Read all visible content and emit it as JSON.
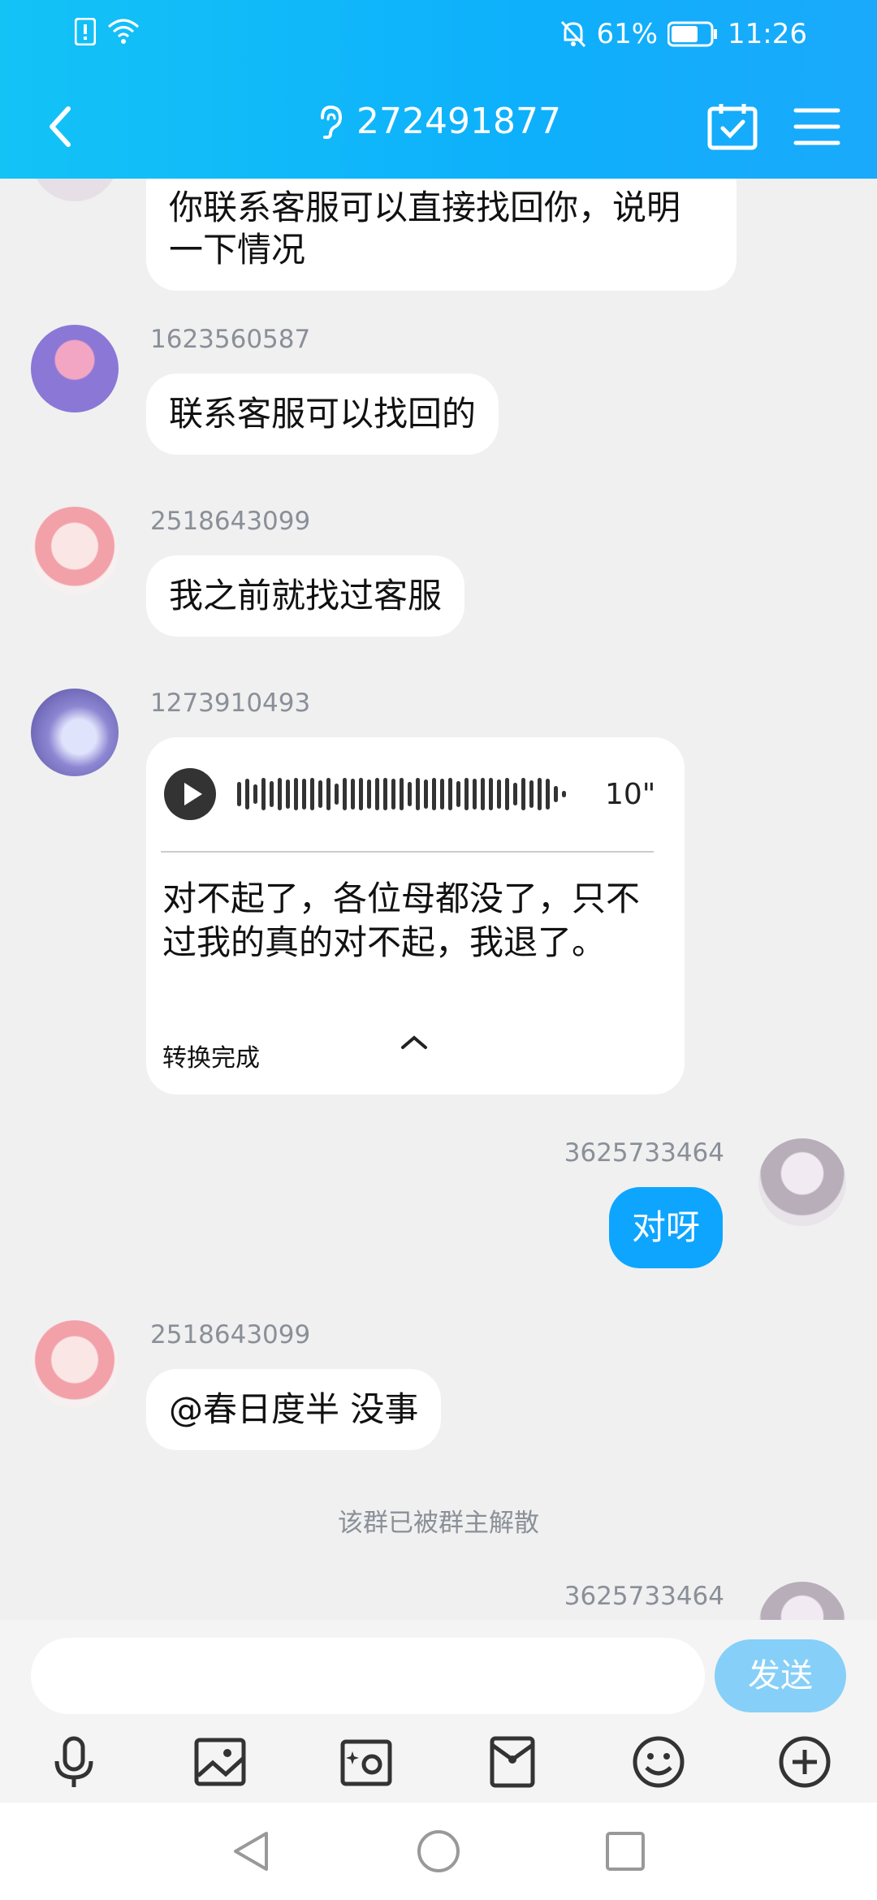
{
  "status_bar": {
    "battery_percent": "61%",
    "time": "11:26"
  },
  "header": {
    "title": "272491877"
  },
  "messages": [
    {
      "text": "你联系客服可以直接找回你，说明一下情况"
    },
    {
      "sender": "1623560587",
      "text": "联系客服可以找回的"
    },
    {
      "sender": "2518643099",
      "text": "我之前就找过客服"
    },
    {
      "sender": "1273910493",
      "voice": {
        "duration": "10\"",
        "transcript": "对不起了，各位母都没了，只不过我的真的对不起，我退了。",
        "status": "转换完成"
      }
    },
    {
      "sender": "3625733464",
      "text": "对呀"
    },
    {
      "sender": "2518643099",
      "text": "@春日度半 没事"
    },
    {
      "sender": "3625733464"
    }
  ],
  "system_note": "该群已被群主解散",
  "input": {
    "placeholder": "",
    "send_label": "发送"
  },
  "colors": {
    "header_gradient_start": "#13c3f6",
    "accent": "#0ea5ff",
    "send_disabled": "#86cff9",
    "background": "#f0f0f0"
  }
}
